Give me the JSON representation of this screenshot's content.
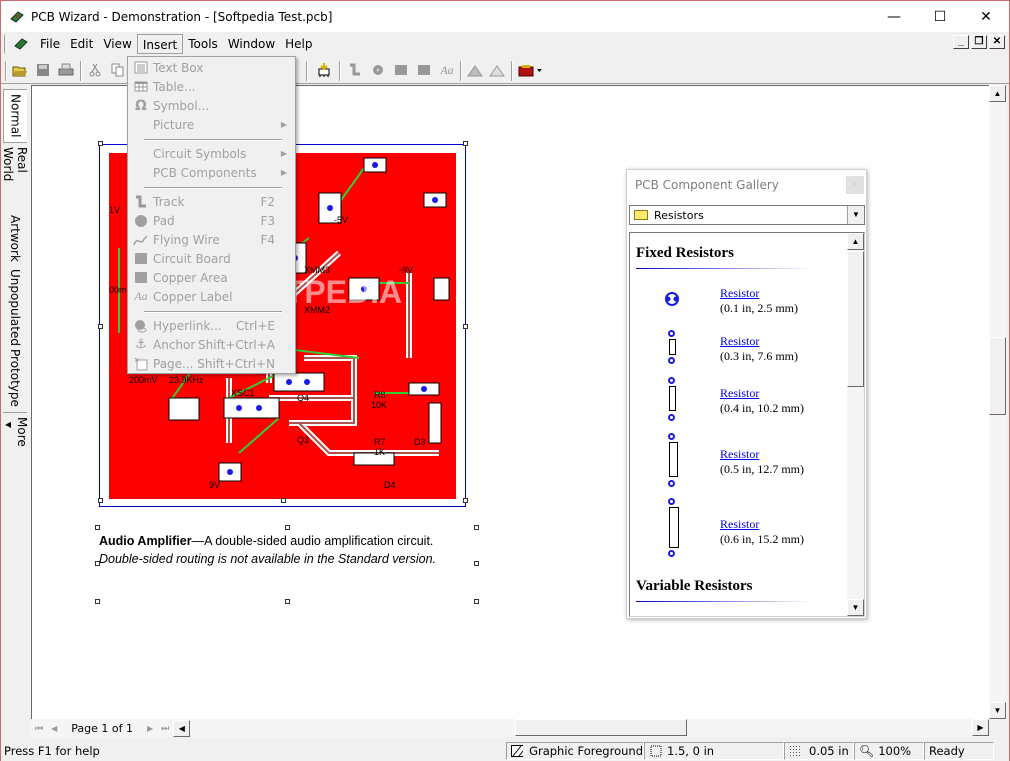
{
  "window": {
    "title": "PCB Wizard - Demonstration - [Softpedia Test.pcb]",
    "controls": {
      "minimize": "—",
      "maximize": "☐",
      "close": "✕"
    },
    "mdi_controls": {
      "minimize": "_",
      "restore": "❐",
      "close": "✕"
    }
  },
  "menubar": {
    "items": [
      {
        "label": "File"
      },
      {
        "label": "Edit"
      },
      {
        "label": "View"
      },
      {
        "label": "Insert",
        "open": true
      },
      {
        "label": "Tools"
      },
      {
        "label": "Window"
      },
      {
        "label": "Help"
      }
    ]
  },
  "toolbar": {
    "buttons": [
      "open-icon",
      "save-icon",
      "print-icon",
      "cut-icon",
      "copy-icon",
      "component-icon",
      "track-icon",
      "pad-icon",
      "circuit-board-icon",
      "copper-area-icon",
      "copper-label-icon",
      "rotate-left-icon",
      "rotate-right-icon",
      "toolbox-icon"
    ]
  },
  "insert_menu": {
    "items": [
      {
        "label": "Text Box",
        "icon": "text-box-icon",
        "shortcut": "",
        "submenu": false
      },
      {
        "label": "Table...",
        "icon": "table-icon",
        "shortcut": "",
        "submenu": false
      },
      {
        "label": "Symbol...",
        "icon": "omega-icon",
        "shortcut": "",
        "submenu": false
      },
      {
        "label": "Picture",
        "icon": "",
        "shortcut": "",
        "submenu": true
      },
      {
        "separator": true
      },
      {
        "label": "Circuit Symbols",
        "icon": "",
        "shortcut": "",
        "submenu": true
      },
      {
        "label": "PCB Components",
        "icon": "",
        "shortcut": "",
        "submenu": true
      },
      {
        "separator": true
      },
      {
        "label": "Track",
        "icon": "track-icon",
        "shortcut": "F2",
        "submenu": false
      },
      {
        "label": "Pad",
        "icon": "pad-icon",
        "shortcut": "F3",
        "submenu": false
      },
      {
        "label": "Flying Wire",
        "icon": "flying-wire-icon",
        "shortcut": "F4",
        "submenu": false
      },
      {
        "label": "Circuit Board",
        "icon": "circuit-board-icon",
        "shortcut": "",
        "submenu": false
      },
      {
        "label": "Copper Area",
        "icon": "copper-area-icon",
        "shortcut": "",
        "submenu": false
      },
      {
        "label": "Copper Label",
        "icon": "copper-label-icon",
        "shortcut": "",
        "submenu": false
      },
      {
        "separator": true
      },
      {
        "label": "Hyperlink...",
        "icon": "hyperlink-icon",
        "shortcut": "Ctrl+E",
        "submenu": false
      },
      {
        "label": "Anchor",
        "icon": "anchor-icon",
        "shortcut": "Shift+Ctrl+A",
        "submenu": false
      },
      {
        "label": "Page...",
        "icon": "page-icon",
        "shortcut": "Shift+Ctrl+N",
        "submenu": false
      }
    ]
  },
  "view_tabs": [
    {
      "label": "Normal",
      "active": true
    },
    {
      "label": "Real World"
    },
    {
      "label": "Artwork"
    },
    {
      "label": "Unpopulated"
    },
    {
      "label": "Prototype"
    },
    {
      "label": "More ◂"
    }
  ],
  "board": {
    "labels": [
      "1V",
      "-5V",
      "-9V",
      "XMM3",
      "XMM2",
      "300m",
      "200mV",
      "23.9KHz",
      "XSC1",
      "Q4",
      "Q3",
      "R8",
      "10K",
      "R7",
      "1K",
      "D3",
      "D4",
      "9V"
    ],
    "board_color": "#ff0000",
    "watermark": "SOFTPEDIA"
  },
  "caption": {
    "bold": "Audio Amplifier",
    "text": "—A double-sided audio amplification circuit.",
    "italic": "Double-sided routing is not available in the Standard version."
  },
  "gallery": {
    "title": "PCB Component Gallery",
    "close": "x",
    "category": "Resistors",
    "sections": [
      {
        "heading": "Fixed Resistors",
        "items": [
          {
            "name": "Resistor",
            "size": "(0.1 in, 2.5 mm)"
          },
          {
            "name": "Resistor",
            "size": "(0.3 in, 7.6 mm)"
          },
          {
            "name": "Resistor",
            "size": "(0.4 in, 10.2 mm)"
          },
          {
            "name": "Resistor",
            "size": "(0.5 in, 12.7 mm)"
          },
          {
            "name": "Resistor",
            "size": "(0.6 in, 15.2 mm)"
          }
        ]
      },
      {
        "heading": "Variable Resistors",
        "items": []
      }
    ]
  },
  "page_nav": {
    "label": "Page 1 of 1"
  },
  "statusbar": {
    "help": "Press F1 for help",
    "layer": "Graphic Foreground",
    "position": "1.5, 0 in",
    "grid": "0.05 in",
    "zoom": "100%",
    "state": "Ready"
  }
}
